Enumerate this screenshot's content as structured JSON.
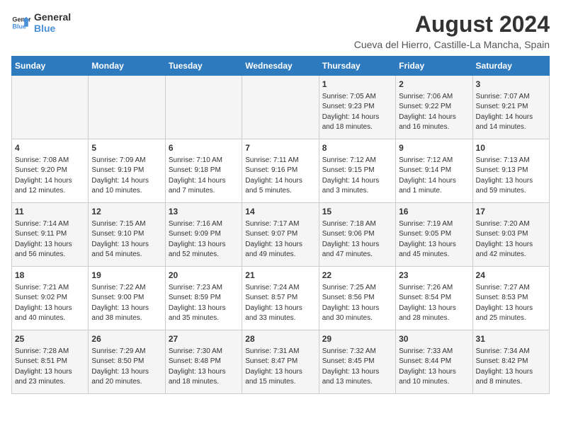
{
  "header": {
    "logo_line1": "General",
    "logo_line2": "Blue",
    "month_year": "August 2024",
    "location": "Cueva del Hierro, Castille-La Mancha, Spain"
  },
  "weekdays": [
    "Sunday",
    "Monday",
    "Tuesday",
    "Wednesday",
    "Thursday",
    "Friday",
    "Saturday"
  ],
  "weeks": [
    [
      {
        "day": "",
        "content": ""
      },
      {
        "day": "",
        "content": ""
      },
      {
        "day": "",
        "content": ""
      },
      {
        "day": "",
        "content": ""
      },
      {
        "day": "1",
        "content": "Sunrise: 7:05 AM\nSunset: 9:23 PM\nDaylight: 14 hours\nand 18 minutes."
      },
      {
        "day": "2",
        "content": "Sunrise: 7:06 AM\nSunset: 9:22 PM\nDaylight: 14 hours\nand 16 minutes."
      },
      {
        "day": "3",
        "content": "Sunrise: 7:07 AM\nSunset: 9:21 PM\nDaylight: 14 hours\nand 14 minutes."
      }
    ],
    [
      {
        "day": "4",
        "content": "Sunrise: 7:08 AM\nSunset: 9:20 PM\nDaylight: 14 hours\nand 12 minutes."
      },
      {
        "day": "5",
        "content": "Sunrise: 7:09 AM\nSunset: 9:19 PM\nDaylight: 14 hours\nand 10 minutes."
      },
      {
        "day": "6",
        "content": "Sunrise: 7:10 AM\nSunset: 9:18 PM\nDaylight: 14 hours\nand 7 minutes."
      },
      {
        "day": "7",
        "content": "Sunrise: 7:11 AM\nSunset: 9:16 PM\nDaylight: 14 hours\nand 5 minutes."
      },
      {
        "day": "8",
        "content": "Sunrise: 7:12 AM\nSunset: 9:15 PM\nDaylight: 14 hours\nand 3 minutes."
      },
      {
        "day": "9",
        "content": "Sunrise: 7:12 AM\nSunset: 9:14 PM\nDaylight: 14 hours\nand 1 minute."
      },
      {
        "day": "10",
        "content": "Sunrise: 7:13 AM\nSunset: 9:13 PM\nDaylight: 13 hours\nand 59 minutes."
      }
    ],
    [
      {
        "day": "11",
        "content": "Sunrise: 7:14 AM\nSunset: 9:11 PM\nDaylight: 13 hours\nand 56 minutes."
      },
      {
        "day": "12",
        "content": "Sunrise: 7:15 AM\nSunset: 9:10 PM\nDaylight: 13 hours\nand 54 minutes."
      },
      {
        "day": "13",
        "content": "Sunrise: 7:16 AM\nSunset: 9:09 PM\nDaylight: 13 hours\nand 52 minutes."
      },
      {
        "day": "14",
        "content": "Sunrise: 7:17 AM\nSunset: 9:07 PM\nDaylight: 13 hours\nand 49 minutes."
      },
      {
        "day": "15",
        "content": "Sunrise: 7:18 AM\nSunset: 9:06 PM\nDaylight: 13 hours\nand 47 minutes."
      },
      {
        "day": "16",
        "content": "Sunrise: 7:19 AM\nSunset: 9:05 PM\nDaylight: 13 hours\nand 45 minutes."
      },
      {
        "day": "17",
        "content": "Sunrise: 7:20 AM\nSunset: 9:03 PM\nDaylight: 13 hours\nand 42 minutes."
      }
    ],
    [
      {
        "day": "18",
        "content": "Sunrise: 7:21 AM\nSunset: 9:02 PM\nDaylight: 13 hours\nand 40 minutes."
      },
      {
        "day": "19",
        "content": "Sunrise: 7:22 AM\nSunset: 9:00 PM\nDaylight: 13 hours\nand 38 minutes."
      },
      {
        "day": "20",
        "content": "Sunrise: 7:23 AM\nSunset: 8:59 PM\nDaylight: 13 hours\nand 35 minutes."
      },
      {
        "day": "21",
        "content": "Sunrise: 7:24 AM\nSunset: 8:57 PM\nDaylight: 13 hours\nand 33 minutes."
      },
      {
        "day": "22",
        "content": "Sunrise: 7:25 AM\nSunset: 8:56 PM\nDaylight: 13 hours\nand 30 minutes."
      },
      {
        "day": "23",
        "content": "Sunrise: 7:26 AM\nSunset: 8:54 PM\nDaylight: 13 hours\nand 28 minutes."
      },
      {
        "day": "24",
        "content": "Sunrise: 7:27 AM\nSunset: 8:53 PM\nDaylight: 13 hours\nand 25 minutes."
      }
    ],
    [
      {
        "day": "25",
        "content": "Sunrise: 7:28 AM\nSunset: 8:51 PM\nDaylight: 13 hours\nand 23 minutes."
      },
      {
        "day": "26",
        "content": "Sunrise: 7:29 AM\nSunset: 8:50 PM\nDaylight: 13 hours\nand 20 minutes."
      },
      {
        "day": "27",
        "content": "Sunrise: 7:30 AM\nSunset: 8:48 PM\nDaylight: 13 hours\nand 18 minutes."
      },
      {
        "day": "28",
        "content": "Sunrise: 7:31 AM\nSunset: 8:47 PM\nDaylight: 13 hours\nand 15 minutes."
      },
      {
        "day": "29",
        "content": "Sunrise: 7:32 AM\nSunset: 8:45 PM\nDaylight: 13 hours\nand 13 minutes."
      },
      {
        "day": "30",
        "content": "Sunrise: 7:33 AM\nSunset: 8:44 PM\nDaylight: 13 hours\nand 10 minutes."
      },
      {
        "day": "31",
        "content": "Sunrise: 7:34 AM\nSunset: 8:42 PM\nDaylight: 13 hours\nand 8 minutes."
      }
    ]
  ]
}
